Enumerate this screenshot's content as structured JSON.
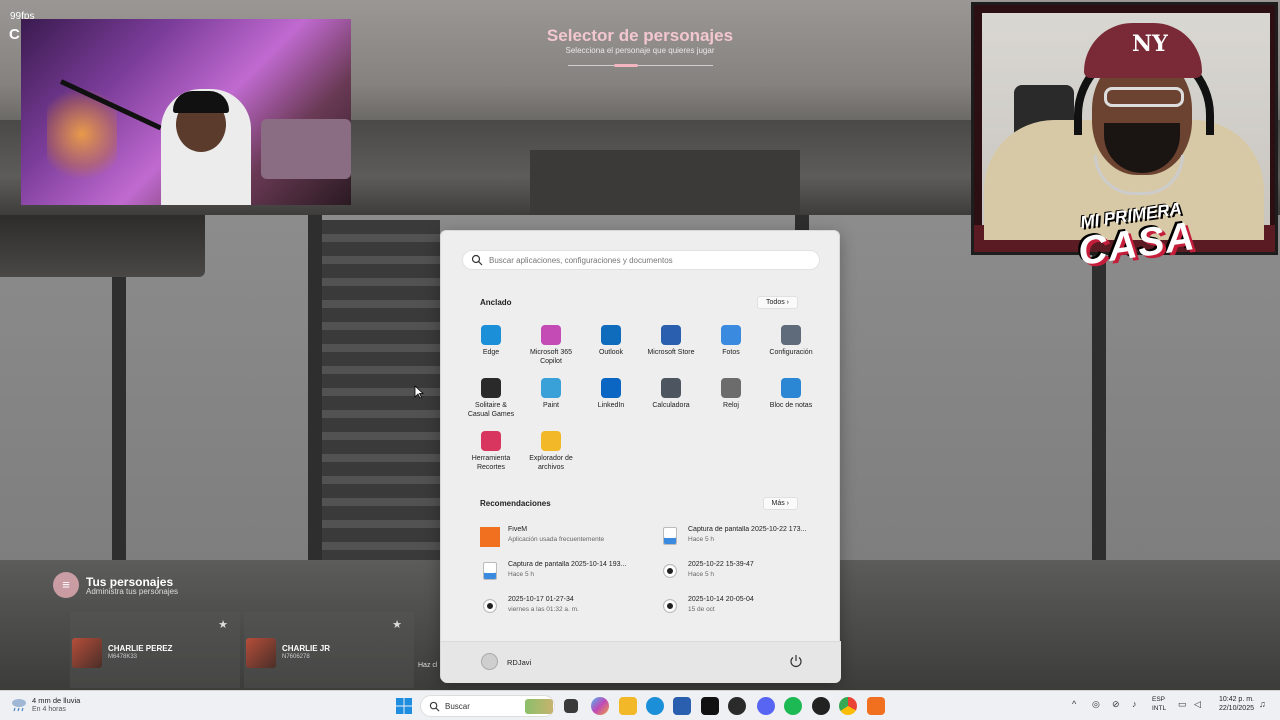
{
  "overlay": {
    "fps": "99fps",
    "fps_logo": "C",
    "selector_title": "Selector de personajes",
    "selector_subtitle": "Selecciona el personaje que quieres jugar",
    "brand_line1": "MI PRIMERA",
    "brand_line2": "CASA"
  },
  "characters_panel": {
    "title": "Tus personajes",
    "subtitle": "Administra tus personajes",
    "cards": [
      {
        "name": "CHARLIE PEREZ",
        "id": "M6478K33"
      },
      {
        "name": "CHARLIE JR",
        "id": "N7606278"
      }
    ],
    "hint": "Haz cl"
  },
  "start_menu": {
    "search_placeholder": "Buscar aplicaciones, configuraciones y documentos",
    "pinned_label": "Anclado",
    "all_button": "Todos  ›",
    "pinned_apps": [
      {
        "label": "Edge",
        "icon": "edge-icon",
        "color": "#1b8fd8"
      },
      {
        "label": "Microsoft 365\nCopilot",
        "icon": "m365-copilot-icon",
        "color": "#c44ab5"
      },
      {
        "label": "Outlook",
        "icon": "outlook-icon",
        "color": "#0f6cbd"
      },
      {
        "label": "Microsoft Store",
        "icon": "store-icon",
        "color": "#2a5fb0"
      },
      {
        "label": "Fotos",
        "icon": "photos-icon",
        "color": "#3a8be0"
      },
      {
        "label": "Configuración",
        "icon": "gear-icon",
        "color": "#5f6b7a"
      },
      {
        "label": "Solitaire &\nCasual Games",
        "icon": "solitaire-icon",
        "color": "#2a2a2a"
      },
      {
        "label": "Paint",
        "icon": "paint-icon",
        "color": "#3aa0d8"
      },
      {
        "label": "LinkedIn",
        "icon": "linkedin-icon",
        "color": "#0a66c2"
      },
      {
        "label": "Calculadora",
        "icon": "calculator-icon",
        "color": "#4d5560"
      },
      {
        "label": "Reloj",
        "icon": "clock-icon",
        "color": "#6c6c6c"
      },
      {
        "label": "Bloc de notas",
        "icon": "notepad-icon",
        "color": "#2b86d3"
      },
      {
        "label": "Herramienta\nRecortes",
        "icon": "snipping-tool-icon",
        "color": "#d8365e"
      },
      {
        "label": "Explorador de\narchivos",
        "icon": "folder-icon",
        "color": "#f2b828"
      }
    ],
    "recommended_label": "Recomendaciones",
    "more_button": "Más  ›",
    "recommended": [
      {
        "title": "FiveM",
        "sub": "Aplicación usada frecuentemente",
        "icon": "fivem-icon"
      },
      {
        "title": "Captura de pantalla 2025-10-22 173...",
        "sub": "Hace 5 h",
        "icon": "image-file-icon"
      },
      {
        "title": "Captura de pantalla 2025-10-14 193...",
        "sub": "Hace 5 h",
        "icon": "image-file-icon"
      },
      {
        "title": "2025-10-22 15-39-47",
        "sub": "Hace 5 h",
        "icon": "video-file-icon"
      },
      {
        "title": "2025-10-17 01-27-34",
        "sub": "viernes a las 01:32 a. m.",
        "icon": "video-file-icon"
      },
      {
        "title": "2025-10-14 20-05-04",
        "sub": "15 de oct",
        "icon": "video-file-icon"
      }
    ],
    "user_name": "RDJavi"
  },
  "taskbar": {
    "weather_line1": "4 mm de lluvia",
    "weather_line2": "En 4 horas",
    "search_label": "Buscar",
    "lang1": "ESP",
    "lang2": "INTL",
    "time": "10:42 p. m.",
    "date": "22/10/2025"
  }
}
